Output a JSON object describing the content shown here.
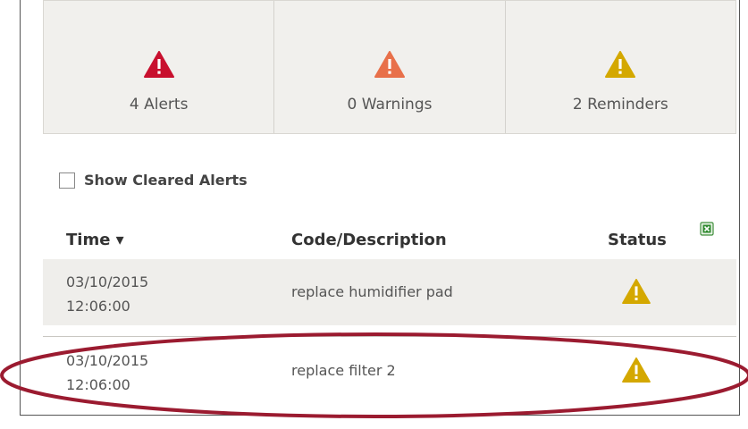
{
  "summary": {
    "alerts": {
      "label": "4 Alerts",
      "icon": "alert-triangle-icon",
      "color": "#c8102e"
    },
    "warnings": {
      "label": "0 Warnings",
      "icon": "warning-triangle-icon",
      "color": "#e8704a"
    },
    "reminders": {
      "label": "2 Reminders",
      "icon": "reminder-triangle-icon",
      "color": "#d4a800"
    }
  },
  "filter": {
    "show_cleared_label": "Show Cleared Alerts",
    "show_cleared_checked": false
  },
  "table": {
    "headers": {
      "time": "Time ▾",
      "code": "Code/Description",
      "status": "Status"
    },
    "export_icon": "excel-export-icon",
    "rows": [
      {
        "date": "03/10/2015",
        "time": "12:06:00",
        "description": "replace humidifier pad",
        "status_icon": "reminder-triangle-icon"
      },
      {
        "date": "03/10/2015",
        "time": "12:06:00",
        "description": "replace filter 2",
        "status_icon": "reminder-triangle-icon"
      }
    ]
  },
  "colors": {
    "highlight_oval": "#9b1b30",
    "panel_bg": "#f1f0ed"
  }
}
